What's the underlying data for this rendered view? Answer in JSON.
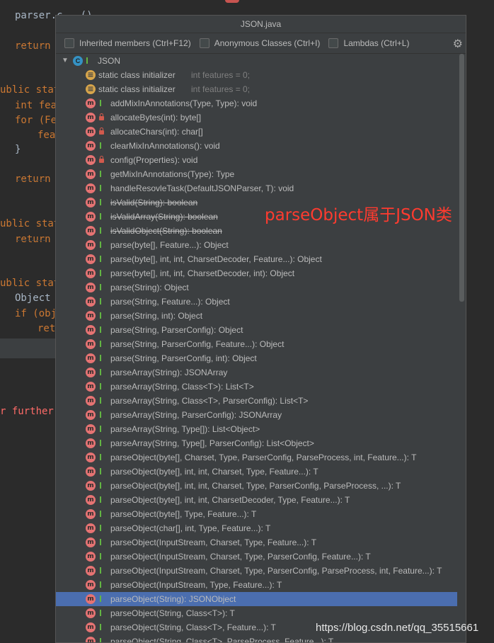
{
  "editor": {
    "lines": [
      {
        "text": "parser.c   ()"
      },
      {
        "text": "return"
      },
      {
        "kw": "",
        "text": "ublic stat"
      },
      {
        "text": "int fea"
      },
      {
        "text": "for (Fe"
      },
      {
        "text": "fea"
      },
      {
        "text": "}"
      },
      {
        "text": "return"
      },
      {
        "text": "ublic stat"
      },
      {
        "text": "return"
      },
      {
        "text": "ublic stat"
      },
      {
        "text": "Object"
      },
      {
        "text": "if (obj"
      },
      {
        "text": "ret"
      },
      {
        "text": "r further"
      }
    ]
  },
  "popup": {
    "title": "JSON.java",
    "filters": [
      {
        "label": "Inherited members (Ctrl+F12)"
      },
      {
        "label": "Anonymous Classes (Ctrl+I)"
      },
      {
        "label": "Lambdas (Ctrl+L)"
      }
    ],
    "settings_icon": "gear-icon",
    "root": {
      "label": "JSON"
    },
    "items": [
      {
        "kind": "init",
        "label": "static class initializer",
        "detail": "int features = 0;"
      },
      {
        "kind": "init",
        "label": "static class initializer",
        "detail": "int features = 0;"
      },
      {
        "kind": "method",
        "vis": "pub",
        "label": "addMixInAnnotations(Type, Type): void"
      },
      {
        "kind": "method",
        "vis": "priv",
        "label": "allocateBytes(int): byte[]"
      },
      {
        "kind": "method",
        "vis": "priv",
        "label": "allocateChars(int): char[]"
      },
      {
        "kind": "method",
        "vis": "pub",
        "label": "clearMixInAnnotations(): void"
      },
      {
        "kind": "method",
        "vis": "priv",
        "label": "config(Properties): void"
      },
      {
        "kind": "method",
        "vis": "pub",
        "label": "getMixInAnnotations(Type): Type"
      },
      {
        "kind": "method",
        "vis": "pub",
        "label": "handleResovleTask(DefaultJSONParser, T): void"
      },
      {
        "kind": "method",
        "vis": "pub",
        "label": "isValid(String): boolean",
        "deprecated": true
      },
      {
        "kind": "method",
        "vis": "pub",
        "label": "isValidArray(String): boolean",
        "deprecated": true
      },
      {
        "kind": "method",
        "vis": "pub",
        "label": "isValidObject(String): boolean",
        "deprecated": true
      },
      {
        "kind": "method",
        "vis": "pub",
        "label": "parse(byte[], Feature...): Object"
      },
      {
        "kind": "method",
        "vis": "pub",
        "label": "parse(byte[], int, int, CharsetDecoder, Feature...): Object"
      },
      {
        "kind": "method",
        "vis": "pub",
        "label": "parse(byte[], int, int, CharsetDecoder, int): Object"
      },
      {
        "kind": "method",
        "vis": "pub",
        "label": "parse(String): Object"
      },
      {
        "kind": "method",
        "vis": "pub",
        "label": "parse(String, Feature...): Object"
      },
      {
        "kind": "method",
        "vis": "pub",
        "label": "parse(String, int): Object"
      },
      {
        "kind": "method",
        "vis": "pub",
        "label": "parse(String, ParserConfig): Object"
      },
      {
        "kind": "method",
        "vis": "pub",
        "label": "parse(String, ParserConfig, Feature...): Object"
      },
      {
        "kind": "method",
        "vis": "pub",
        "label": "parse(String, ParserConfig, int): Object"
      },
      {
        "kind": "method",
        "vis": "pub",
        "label": "parseArray(String): JSONArray"
      },
      {
        "kind": "method",
        "vis": "pub",
        "label": "parseArray(String, Class<T>): List<T>"
      },
      {
        "kind": "method",
        "vis": "pub",
        "label": "parseArray(String, Class<T>, ParserConfig): List<T>"
      },
      {
        "kind": "method",
        "vis": "pub",
        "label": "parseArray(String, ParserConfig): JSONArray"
      },
      {
        "kind": "method",
        "vis": "pub",
        "label": "parseArray(String, Type[]): List<Object>"
      },
      {
        "kind": "method",
        "vis": "pub",
        "label": "parseArray(String, Type[], ParserConfig): List<Object>"
      },
      {
        "kind": "method",
        "vis": "pub",
        "label": "parseObject(byte[], Charset, Type, ParserConfig, ParseProcess, int, Feature...): T"
      },
      {
        "kind": "method",
        "vis": "pub",
        "label": "parseObject(byte[], int, int, Charset, Type, Feature...): T"
      },
      {
        "kind": "method",
        "vis": "pub",
        "label": "parseObject(byte[], int, int, Charset, Type, ParserConfig, ParseProcess, ...): T"
      },
      {
        "kind": "method",
        "vis": "pub",
        "label": "parseObject(byte[], int, int, CharsetDecoder, Type, Feature...): T"
      },
      {
        "kind": "method",
        "vis": "pub",
        "label": "parseObject(byte[], Type, Feature...): T"
      },
      {
        "kind": "method",
        "vis": "pub",
        "label": "parseObject(char[], int, Type, Feature...): T"
      },
      {
        "kind": "method",
        "vis": "pub",
        "label": "parseObject(InputStream, Charset, Type, Feature...): T"
      },
      {
        "kind": "method",
        "vis": "pub",
        "label": "parseObject(InputStream, Charset, Type, ParserConfig, Feature...): T"
      },
      {
        "kind": "method",
        "vis": "pub",
        "label": "parseObject(InputStream, Charset, Type, ParserConfig, ParseProcess, int, Feature...): T"
      },
      {
        "kind": "method",
        "vis": "pub",
        "label": "parseObject(InputStream, Type, Feature...): T"
      },
      {
        "kind": "method",
        "vis": "pub",
        "label": "parseObject(String): JSONObject",
        "selected": true
      },
      {
        "kind": "method",
        "vis": "pub",
        "label": "parseObject(String, Class<T>): T"
      },
      {
        "kind": "method",
        "vis": "pub",
        "label": "parseObject(String, Class<T>, Feature...): T"
      },
      {
        "kind": "method",
        "vis": "pub",
        "label": "parseObject(String, Class<T>, ParseProcess, Feature...): T"
      }
    ]
  },
  "annotation": "parseObject属于JSON类",
  "watermark": "https://blog.csdn.net/qq_35515661",
  "colors": {
    "selection": "#4b6eaf",
    "method_icon": "#e57373",
    "annotation": "#ff3b2f",
    "public": "#62b543",
    "private": "#d15a4d"
  }
}
